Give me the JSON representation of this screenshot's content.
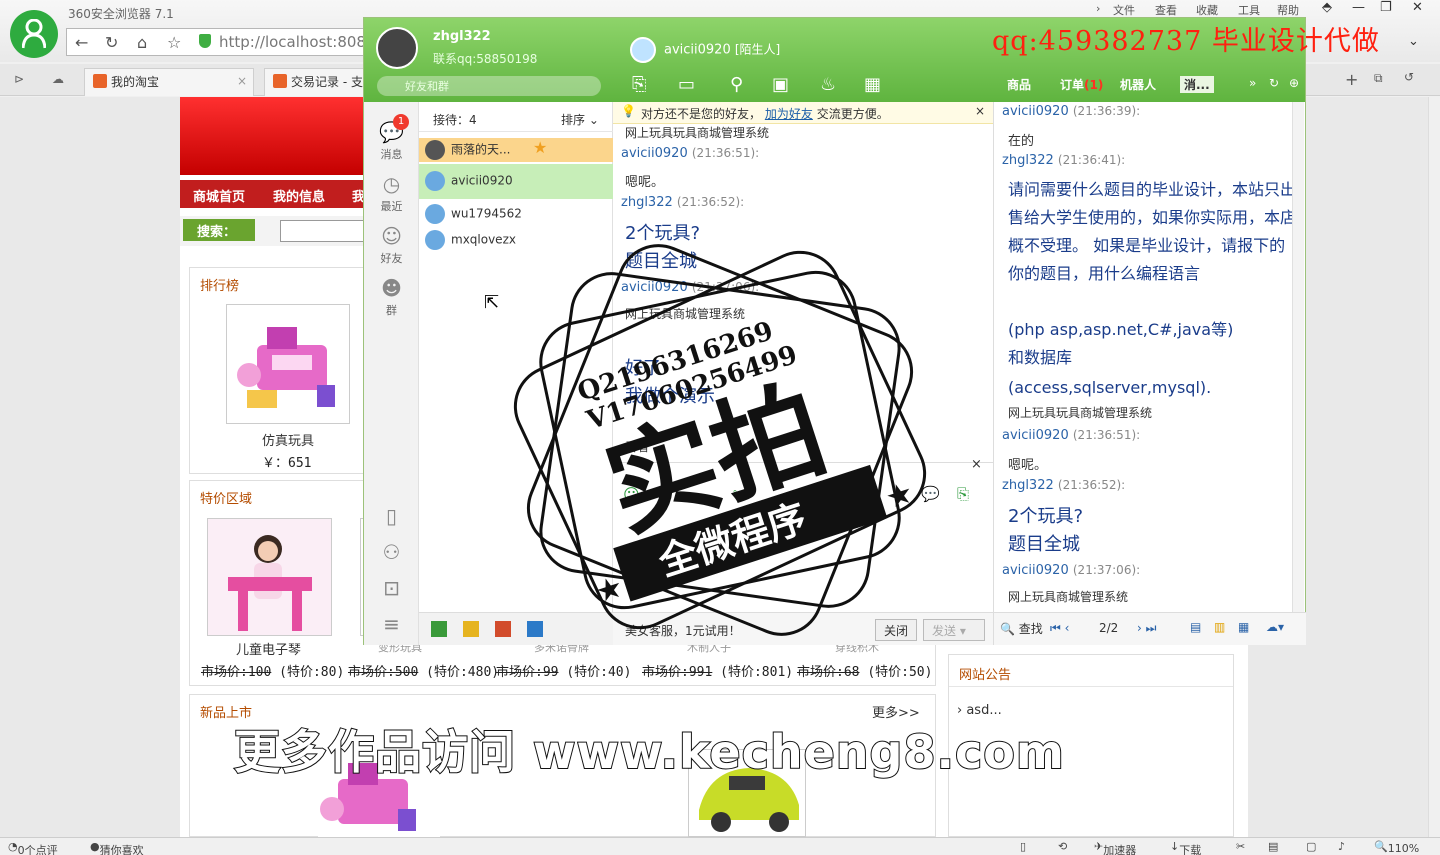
{
  "browser": {
    "name": "360安全浏览器 7.1",
    "url": "http://localhost:808",
    "menu": [
      "文件",
      "查看",
      "收藏",
      "工具",
      "帮助"
    ],
    "tabs": [
      {
        "label": "我的淘宝"
      },
      {
        "label": "交易记录 - 支"
      }
    ],
    "status": {
      "reviews": "0个点评",
      "guess": "猜你喜欢",
      "accelerator": "加速器",
      "download": "下载",
      "zoom": "110%"
    }
  },
  "site": {
    "nav": [
      "商城首页",
      "我的信息",
      "我"
    ],
    "search_label": "搜索：",
    "ranking": {
      "title": "排行榜",
      "item_name": "仿真玩具",
      "item_price": "￥：651"
    },
    "special": {
      "title": "特价区域",
      "item_name": "儿童电子琴",
      "hidden_names": [
        "变形玩具",
        "多米诺骨牌",
        "木制人子",
        "穿线积木"
      ],
      "prices": [
        "市场价:100",
        "(特价:80)",
        "市场价:500",
        "(特价:480)",
        "市场价:99",
        "(特价:40)",
        "市场价:991",
        "(特价:801)",
        "市场价:68",
        "(特价:50)"
      ]
    },
    "new_arrivals": {
      "title": "新品上市",
      "more": "更多>>"
    },
    "announcement": {
      "title": "网站公告",
      "items": [
        "asd..."
      ]
    }
  },
  "qq": {
    "user": {
      "name": "zhgl322",
      "contact": "联系qq:58850198",
      "search_placeholder": "好友和群"
    },
    "peer": {
      "name": "avicii0920",
      "tag": "[陌生人]"
    },
    "ad_text": "qq:459382737  毕业设计代做",
    "top_tabs": [
      "商品",
      "订单",
      "(1)",
      "机器人",
      "消..."
    ],
    "left_nav": [
      {
        "label": "消息",
        "badge": "1"
      },
      {
        "label": "最近"
      },
      {
        "label": "好友"
      },
      {
        "label": "群"
      }
    ],
    "contacts": {
      "reception": "接待：4",
      "sort": "排序",
      "items": [
        "雨落的天...",
        "avicii0920",
        "wu1794562",
        "mxqlovezx"
      ]
    },
    "notice": {
      "text1": "对方还不是您的好友，",
      "link": "加为好友",
      "text2": "交流更方便。"
    },
    "chat": {
      "top_partial": "网上玩具玩具商城管理系统",
      "m1_who": "avicii0920",
      "m1_time": "(21:36:51):",
      "m1_text": "嗯呢。",
      "m2_who": "zhgl322",
      "m2_time": "(21:36:52):",
      "m2_line1": "2个玩具?",
      "m2_line2": "题目全城",
      "m3_who": "avicii0920",
      "m3_time": "(21:37:06):",
      "m3_text": "网上玩具商城管理系统",
      "m4_line1": "好了",
      "m4_line2": "我做个演示",
      "m5_text": "看看"
    },
    "footer": {
      "promo": "美女客服，1元试用！",
      "close": "关闭",
      "send": "发送"
    },
    "history": {
      "h1_who": "avicii0920",
      "h1_time": "(21:36:39):",
      "h1_text": "在的",
      "h2_who": "zhgl322",
      "h2_time": "(21:36:41):",
      "h2_text": "请问需要什么题目的毕业设计，本站只出售给大学生使用的，如果你实际用，本店概不受理。 如果是毕业设计，请报下的你的题目，用什么编程语言",
      "h2_text2": "(php asp,asp.net,C#,java等)",
      "h2_text3": "和数据库",
      "h2_text4": "(access,sqlserver,mysql).",
      "h2_text5": "网上玩具玩具商城管理系统",
      "h3_who": "avicii0920",
      "h3_time": "(21:36:51):",
      "h3_text": "嗯呢。",
      "h4_who": "zhgl322",
      "h4_time": "(21:36:52):",
      "h4_line1": "2个玩具?",
      "h4_line2": "题目全城",
      "h5_who": "avicii0920",
      "h5_time": "(21:37:06):",
      "h5_text": "网上玩具商城管理系统",
      "find": "查找",
      "page": "2/2"
    }
  },
  "watermark": {
    "stamp_q": "Q2196316269",
    "stamp_v": "V17060256499",
    "stamp_main": "实拍",
    "stamp_ribbon": "全微程序",
    "bottom": "更多作品访问 www.kecheng8.com"
  },
  "colors": {
    "qq_green": "#6cc04a",
    "site_red": "#c11e1e",
    "ad_red": "#ff2010",
    "link_blue": "#2b63a8"
  }
}
